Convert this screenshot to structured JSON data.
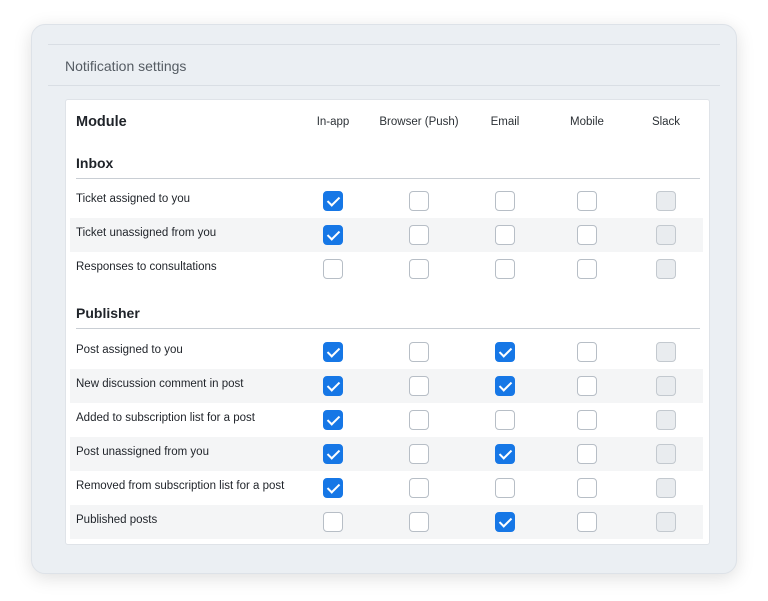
{
  "section_title": "Notification settings",
  "module_header": "Module",
  "columns": [
    "In-app",
    "Browser (Push)",
    "Email",
    "Mobile",
    "Slack"
  ],
  "groups": [
    {
      "title": "Inbox",
      "rows": [
        {
          "label": "Ticket assigned to you",
          "checked": [
            true,
            false,
            false,
            false,
            false
          ]
        },
        {
          "label": "Ticket unassigned from you",
          "checked": [
            true,
            false,
            false,
            false,
            false
          ]
        },
        {
          "label": "Responses to consultations",
          "checked": [
            false,
            false,
            false,
            false,
            false
          ]
        }
      ]
    },
    {
      "title": "Publisher",
      "rows": [
        {
          "label": "Post assigned to you",
          "checked": [
            true,
            false,
            true,
            false,
            false
          ]
        },
        {
          "label": "New discussion comment in post",
          "checked": [
            true,
            false,
            true,
            false,
            false
          ]
        },
        {
          "label": "Added to subscription list for a post",
          "checked": [
            true,
            false,
            false,
            false,
            false
          ]
        },
        {
          "label": "Post unassigned from you",
          "checked": [
            true,
            false,
            true,
            false,
            false
          ]
        },
        {
          "label": "Removed from subscription list for a post",
          "checked": [
            true,
            false,
            false,
            false,
            false
          ]
        },
        {
          "label": "Published posts",
          "checked": [
            false,
            false,
            true,
            false,
            false
          ]
        }
      ]
    }
  ],
  "disabled_columns": [
    "Slack"
  ],
  "colors": {
    "accent": "#1677e6",
    "window_bg": "#ebeff3",
    "row_shade": "#f4f5f6"
  }
}
